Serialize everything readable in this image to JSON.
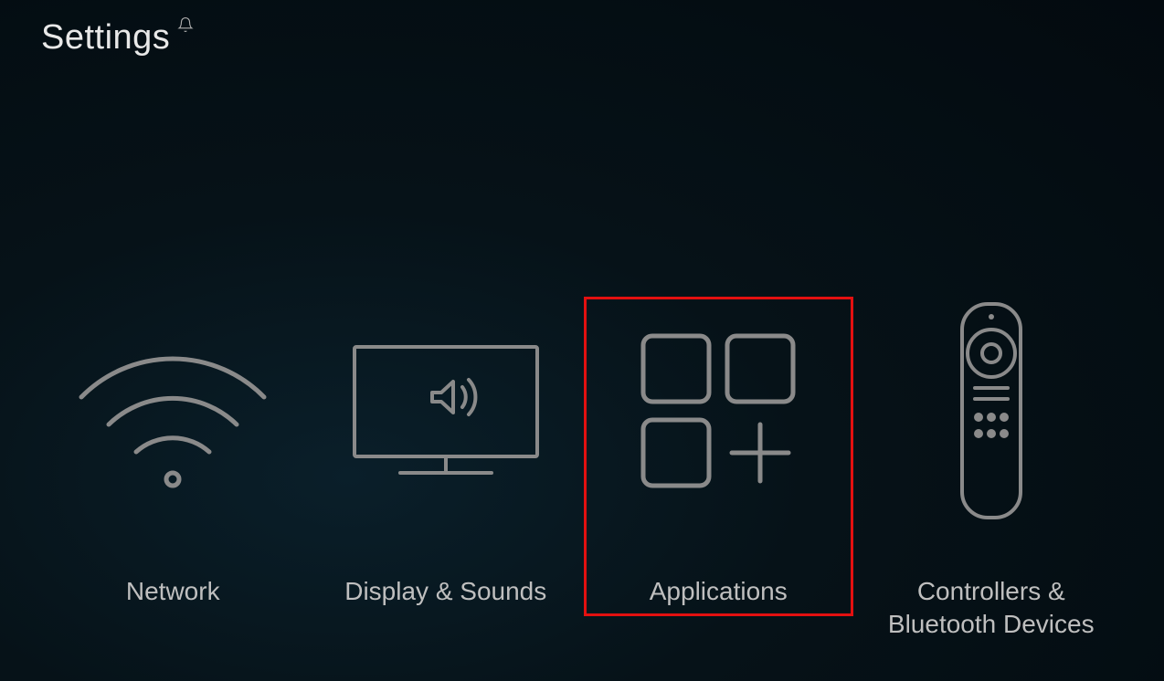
{
  "header": {
    "title": "Settings"
  },
  "tiles": [
    {
      "label": "Network"
    },
    {
      "label": "Display & Sounds"
    },
    {
      "label": "Applications"
    },
    {
      "label": "Controllers & Bluetooth Devices"
    }
  ],
  "highlighted_index": 2
}
